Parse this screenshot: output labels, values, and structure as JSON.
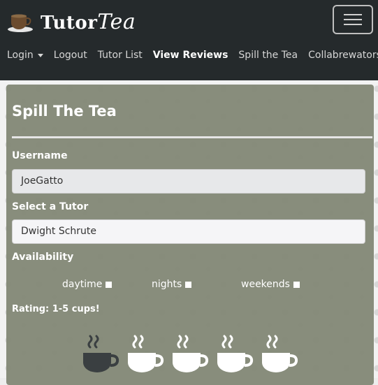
{
  "navbar": {
    "brand": {
      "name": "Tutor",
      "name_accent": "Tea",
      "logo_icon": "teacup-icon"
    },
    "links": [
      {
        "label": "Login"
      },
      {
        "label": "Logout"
      },
      {
        "label": "Tutor List"
      },
      {
        "label": "View Reviews"
      },
      {
        "label": "Spill the Tea"
      },
      {
        "label": "Collabrewators"
      }
    ]
  },
  "form": {
    "title": "Spill The Tea",
    "username_label": "Username",
    "username_value": "JoeGatto",
    "tutor_label": "Select a Tutor",
    "tutor_value": "Dwight Schrute",
    "availability_label": "Availability",
    "availability_options": [
      {
        "label": "daytime"
      },
      {
        "label": "nights"
      },
      {
        "label": "weekends"
      }
    ],
    "rating_label": "Rating: 1-5 cups!",
    "rating_selected": 1,
    "rating_max": 5
  },
  "colors": {
    "navbar_bg": "#252a2c",
    "card_bg": "#808573",
    "cup_selected": "#3a3f41",
    "cup_unselected": "#ffffff"
  }
}
